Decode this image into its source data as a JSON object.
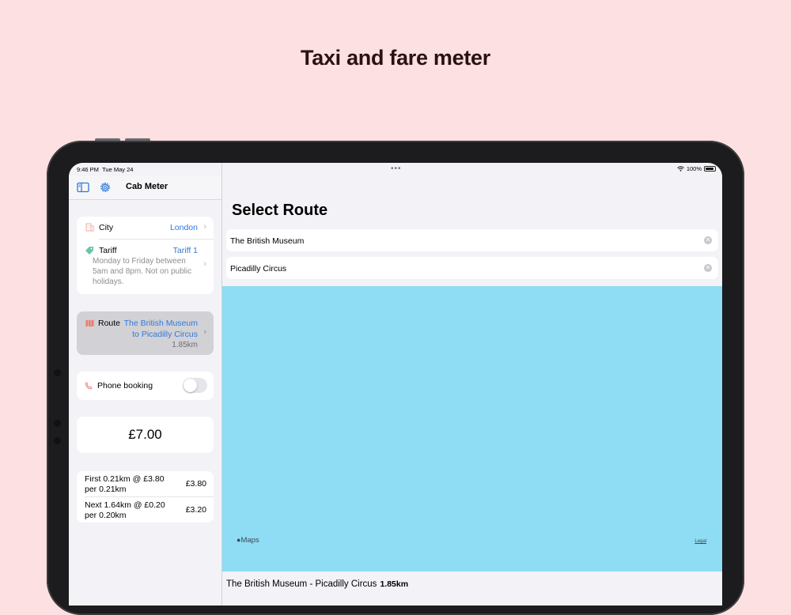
{
  "headline": "Taxi and fare meter",
  "status_bar": {
    "time": "9:46 PM",
    "date": "Tue May 24",
    "battery": "100%"
  },
  "sidebar": {
    "title": "Cab Meter",
    "city": {
      "label": "City",
      "value": "London"
    },
    "tariff": {
      "label": "Tariff",
      "value": "Tariff 1",
      "description_lines": [
        "Monday to Friday between",
        "5am and 8pm. Not on public",
        "holidays."
      ]
    },
    "route": {
      "label": "Route",
      "value_lines": [
        "The British Museum",
        "to Picadilly Circus"
      ],
      "distance": "1.85km"
    },
    "phone_booking": {
      "label": "Phone booking",
      "enabled": false
    },
    "total_fare": "£7.00",
    "breakdown": [
      {
        "lines": [
          "First 0.21km @ £3.80",
          "per 0.21km"
        ],
        "amount": "£3.80"
      },
      {
        "lines": [
          "Next 1.64km @ £0.20",
          "per 0.20km"
        ],
        "amount": "£3.20"
      }
    ]
  },
  "main": {
    "title": "Select Route",
    "from_value": "The British Museum",
    "to_value": "Picadilly Circus",
    "maps_attribution": "Maps",
    "legal_link": "Legal",
    "summary_route": "The British Museum - Picadilly Circus",
    "summary_distance": "1.85km"
  },
  "colors": {
    "background": "#fde0e1",
    "accent": "#2f7ad8",
    "map_water": "#8fdcf5"
  }
}
